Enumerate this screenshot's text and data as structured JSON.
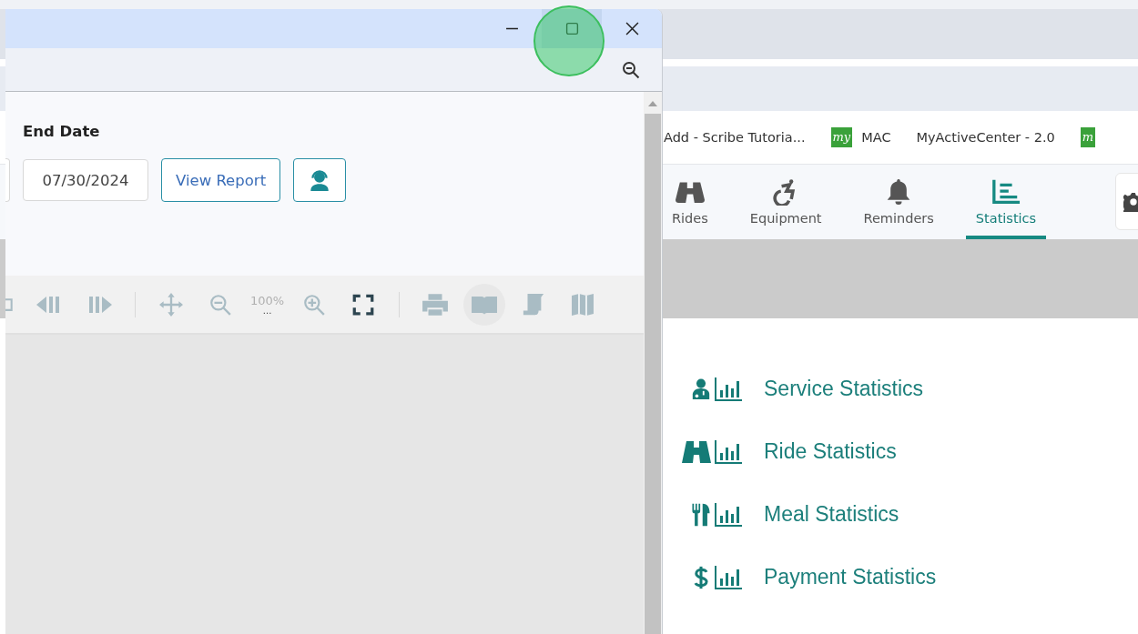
{
  "popup": {
    "end_date_label": "End Date",
    "end_date": "07/30/2024",
    "view_button": "View Report",
    "zoom_level": "100%",
    "zoom_more": "..."
  },
  "bookmarks": [
    {
      "label": "Add - Scribe Tutoria..."
    },
    {
      "logo": "my",
      "label": "MAC"
    },
    {
      "label": "MyActiveCenter - 2.0"
    },
    {
      "logo": "m"
    }
  ],
  "nav_tabs": [
    {
      "label": "Rides",
      "kind": "binoculars",
      "selected": false
    },
    {
      "label": "Equipment",
      "kind": "wheelchair",
      "selected": false
    },
    {
      "label": "Reminders",
      "kind": "bell",
      "selected": false
    },
    {
      "label": "Statistics",
      "kind": "chart",
      "selected": true
    }
  ],
  "statistics": [
    {
      "label": "Service Statistics",
      "kind": "doctor"
    },
    {
      "label": "Ride Statistics",
      "kind": "binoculars"
    },
    {
      "label": "Meal Statistics",
      "kind": "utensils"
    },
    {
      "label": "Payment Statistics",
      "kind": "dollar"
    }
  ]
}
